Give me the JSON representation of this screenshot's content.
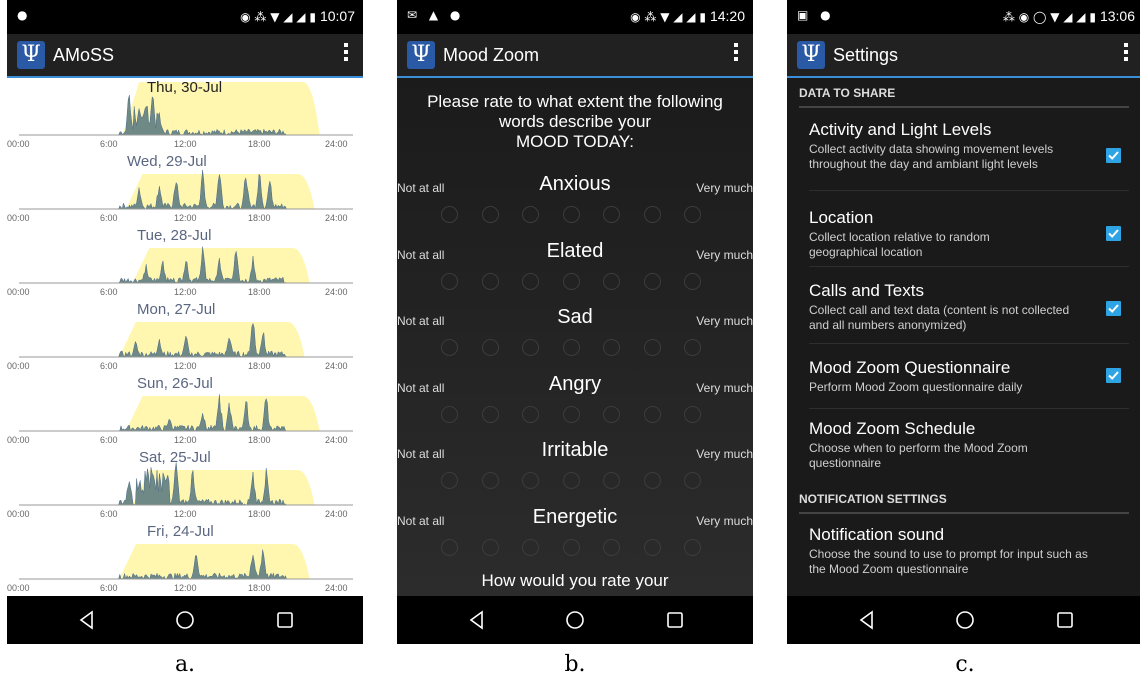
{
  "panels": [
    {
      "status_time": "10:07",
      "app_title": "AMoSS",
      "caption": "a.",
      "days": [
        {
          "label": "Thu, 30-Jul"
        },
        {
          "label": "Wed, 29-Jul"
        },
        {
          "label": "Tue, 28-Jul"
        },
        {
          "label": "Mon, 27-Jul"
        },
        {
          "label": "Sun, 26-Jul"
        },
        {
          "label": "Sat, 25-Jul"
        },
        {
          "label": "Fri, 24-Jul"
        }
      ],
      "ticks": [
        "00:00",
        "6:00",
        "12:00",
        "18:00",
        "24:00"
      ]
    },
    {
      "status_time": "14:20",
      "app_title": "Mood Zoom",
      "caption": "b.",
      "prompt_lines": [
        "Please rate to what extent the following",
        "words describe your",
        "MOOD TODAY:"
      ],
      "scale_low": "Not at all",
      "scale_high": "Very much",
      "moods": [
        "Anxious",
        "Elated",
        "Sad",
        "Angry",
        "Irritable",
        "Energetic"
      ],
      "next_prompt": "How would you rate your"
    },
    {
      "status_time": "13:06",
      "app_title": "Settings",
      "caption": "c.",
      "section_share": "DATA TO SHARE",
      "settings": [
        {
          "title": "Activity and Light Levels",
          "desc": "Collect activity data showing movement levels throughout the day and ambiant light levels",
          "checked": true
        },
        {
          "title": "Location",
          "desc": "Collect location relative to random geographical location",
          "checked": true
        },
        {
          "title": "Calls and Texts",
          "desc": "Collect call and text data (content is not collected and all numbers anonymized)",
          "checked": true
        },
        {
          "title": "Mood Zoom Questionnaire",
          "desc": "Perform Mood Zoom questionnaire daily",
          "checked": true
        },
        {
          "title": "Mood Zoom Schedule",
          "desc": "Choose when to perform the Mood Zoom questionnaire"
        }
      ],
      "section_notify": "NOTIFICATION SETTINGS",
      "notify_setting": {
        "title": "Notification sound",
        "desc": "Choose the sound to use to prompt for input such as the Mood Zoom questionnaire"
      }
    }
  ],
  "colors": {
    "accent": "#3b8fd8",
    "checkbox": "#2fa4e4",
    "light_area": "#fff7b0",
    "activity": "#6f8a86"
  }
}
